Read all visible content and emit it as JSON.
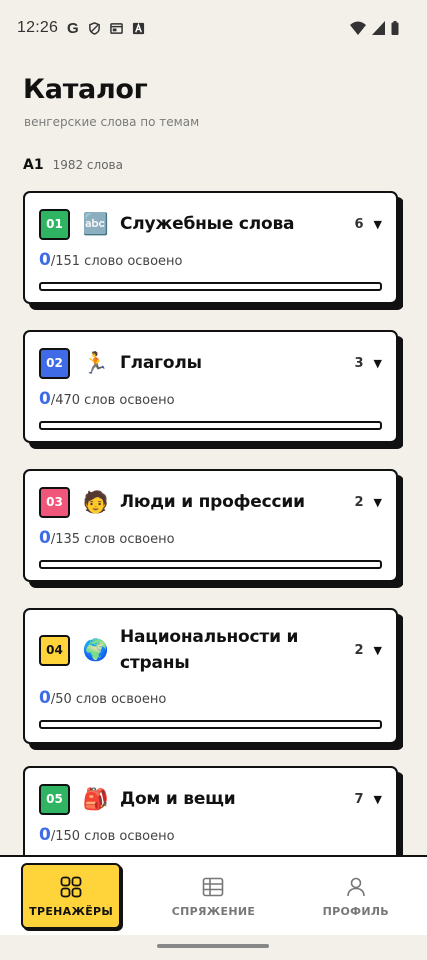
{
  "status_bar": {
    "time": "12:26",
    "google_glyph": "G"
  },
  "header": {
    "title": "Каталог",
    "subtitle": "венгерские слова по темам"
  },
  "level": {
    "code": "A1",
    "word_count": "1982 слова"
  },
  "categories": [
    {
      "number": "01",
      "badge_color": "#2fb463",
      "emoji": "🔤",
      "title": "Служебные слова",
      "subcategory_count": "6",
      "learned": "0",
      "total_text": "/151 слово освоено",
      "progress": 0
    },
    {
      "number": "02",
      "badge_color": "#3f6ce6",
      "emoji": "🏃",
      "title": "Глаголы",
      "subcategory_count": "3",
      "learned": "0",
      "total_text": "/470 слов освоено",
      "progress": 0
    },
    {
      "number": "03",
      "badge_color": "#f0567a",
      "emoji": "🧑",
      "title": "Люди и профессии",
      "subcategory_count": "2",
      "learned": "0",
      "total_text": "/135 слов освоено",
      "progress": 0
    },
    {
      "number": "04",
      "badge_color": "#ffd43b",
      "emoji": "🌍",
      "title": "Национальности и страны",
      "subcategory_count": "2",
      "learned": "0",
      "total_text": "/50 слов освоено",
      "progress": 0
    },
    {
      "number": "05",
      "badge_color": "#2fb463",
      "emoji": "🎒",
      "title": "Дом и вещи",
      "subcategory_count": "7",
      "learned": "0",
      "total_text": "/150 слов освоено",
      "progress": 0
    }
  ],
  "chevron_glyph": "▼",
  "nav": [
    {
      "label": "ТРЕНАЖЁРЫ",
      "icon": "grid-icon",
      "active": true
    },
    {
      "label": "СПРЯЖЕНИЕ",
      "icon": "table-icon",
      "active": false
    },
    {
      "label": "ПРОФИЛЬ",
      "icon": "person-icon",
      "active": false
    }
  ],
  "colors": {
    "accent_blue": "#3f6ce6",
    "active_nav": "#ffd43b",
    "background": "#f3f0ea"
  }
}
